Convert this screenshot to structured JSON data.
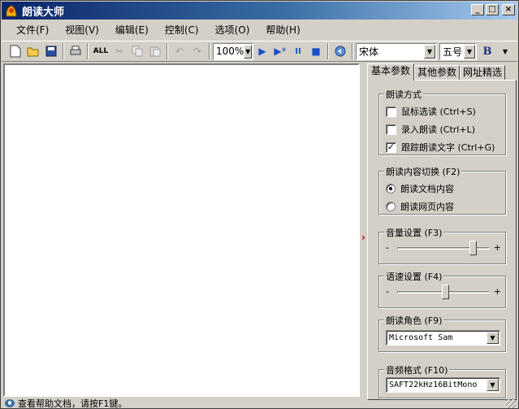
{
  "window": {
    "title": "朗读大师",
    "controls": {
      "minimize": "_",
      "maximize": "□",
      "close": "×"
    }
  },
  "menu": [
    {
      "label": "文件(F)"
    },
    {
      "label": "视图(V)"
    },
    {
      "label": "编辑(E)"
    },
    {
      "label": "控制(C)"
    },
    {
      "label": "选项(O)"
    },
    {
      "label": "帮助(H)"
    }
  ],
  "toolbar": {
    "select_all_label": "ALL",
    "zoom": "100%",
    "font": "宋体",
    "font_size": "五号",
    "bold_label": "B"
  },
  "tabs": [
    {
      "label": "基本参数",
      "active": true
    },
    {
      "label": "其他参数",
      "active": false
    },
    {
      "label": "网址精选",
      "active": false
    }
  ],
  "reading_mode": {
    "title": "朗读方式",
    "options": [
      {
        "label": "鼠标选读 (Ctrl+S)",
        "checked": false
      },
      {
        "label": "录入朗读 (Ctrl+L)",
        "checked": false
      },
      {
        "label": "跟踪朗读文字 (Ctrl+G)",
        "checked": true
      }
    ]
  },
  "content_switch": {
    "title": "朗读内容切换 (F2)",
    "options": [
      {
        "label": "朗读文档内容",
        "selected": true
      },
      {
        "label": "朗读网页内容",
        "selected": false
      }
    ]
  },
  "volume": {
    "title": "音量设置 (F3)",
    "minus": "-",
    "plus": "+",
    "level": 0.82
  },
  "speed": {
    "title": "语速设置 (F4)",
    "minus": "-",
    "plus": "+",
    "level": 0.52
  },
  "voice": {
    "title": "朗读角色 (F9)",
    "value": "Microsoft Sam"
  },
  "audio_format": {
    "title": "音频格式 (F10)",
    "value": "SAFT22kHz16BitMono"
  },
  "status": {
    "text": "查看帮助文档，请按F1键。"
  },
  "colors": {
    "title_start": "#0a246a",
    "title_end": "#a6caf0",
    "face": "#d4d0c8",
    "splitter_arrow": "#c00000"
  }
}
